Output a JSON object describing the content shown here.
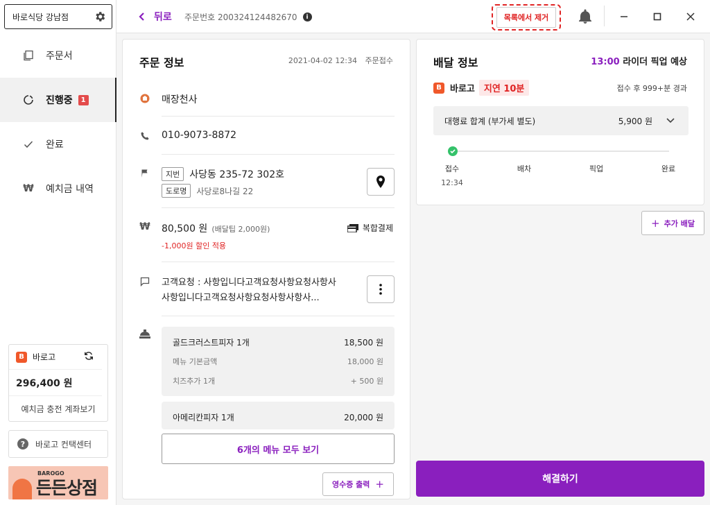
{
  "sidebar": {
    "store_name": "바로식당 강남점",
    "items": [
      {
        "label": "주문서"
      },
      {
        "label": "진행중",
        "badge": "1"
      },
      {
        "label": "완료"
      },
      {
        "label": "예치금 내역"
      }
    ],
    "deposit": {
      "brand": "바로고",
      "amount": "296,400 원",
      "link": "예치금 충전 계좌보기"
    },
    "cs_label": "바로고 컨택센터",
    "banner": {
      "brand": "BAROGO",
      "title": "든든상점"
    }
  },
  "topbar": {
    "back_label": "뒤로",
    "order_number": "주문번호 200324124482670",
    "remove_label": "목록에서 제거"
  },
  "order": {
    "title": "주문 정보",
    "datetime": "2021-04-02 12:34",
    "status": "주문접수",
    "store": "매장천사",
    "phone": "010-9073-8872",
    "address": {
      "lot_tag": "지번",
      "lot": "사당동 235-72 302호",
      "road_tag": "도로명",
      "road": "사당로8나길 22"
    },
    "price": {
      "amount": "80,500 원",
      "tip": "(배달팁 2,000원)",
      "payment": "복합결제",
      "discount": "-1,000원 할인 적용"
    },
    "request": {
      "line1": "고객요청 : 사항입니다고객요청사항요청사항사",
      "line2": "사항입니다고객요청사항요청사항사항사..."
    },
    "menus": [
      {
        "name": "골드크러스트피자 1개",
        "price": "18,500 원",
        "subs": [
          {
            "name": "메뉴 기본금액",
            "price": "18,000 원"
          },
          {
            "name": "치즈추가 1개",
            "price": "+ 500 원"
          }
        ]
      },
      {
        "name": "아메리칸피자 1개",
        "price": "20,000 원"
      }
    ],
    "all_menu_label": "6개의 메뉴 모두 보기",
    "receipt_label": "영수증 출력"
  },
  "delivery": {
    "title": "배달 정보",
    "pickup_time": "13:00",
    "pickup_text": "라이더 픽업 예상",
    "company": "바로고",
    "delay": "지연 10분",
    "elapsed": "접수 후 999+분 경과",
    "fee_label": "대행료 합계 (부가세 별도)",
    "fee_value": "5,900 원",
    "steps": [
      {
        "label": "접수",
        "time": "12:34"
      },
      {
        "label": "배차",
        "time": ""
      },
      {
        "label": "픽업",
        "time": ""
      },
      {
        "label": "완료",
        "time": ""
      }
    ],
    "add_label": "추가 배달",
    "solve_label": "해결하기"
  },
  "colors": {
    "accent": "#8a1fbe",
    "alert": "#e02424",
    "brand": "#f0582a"
  }
}
